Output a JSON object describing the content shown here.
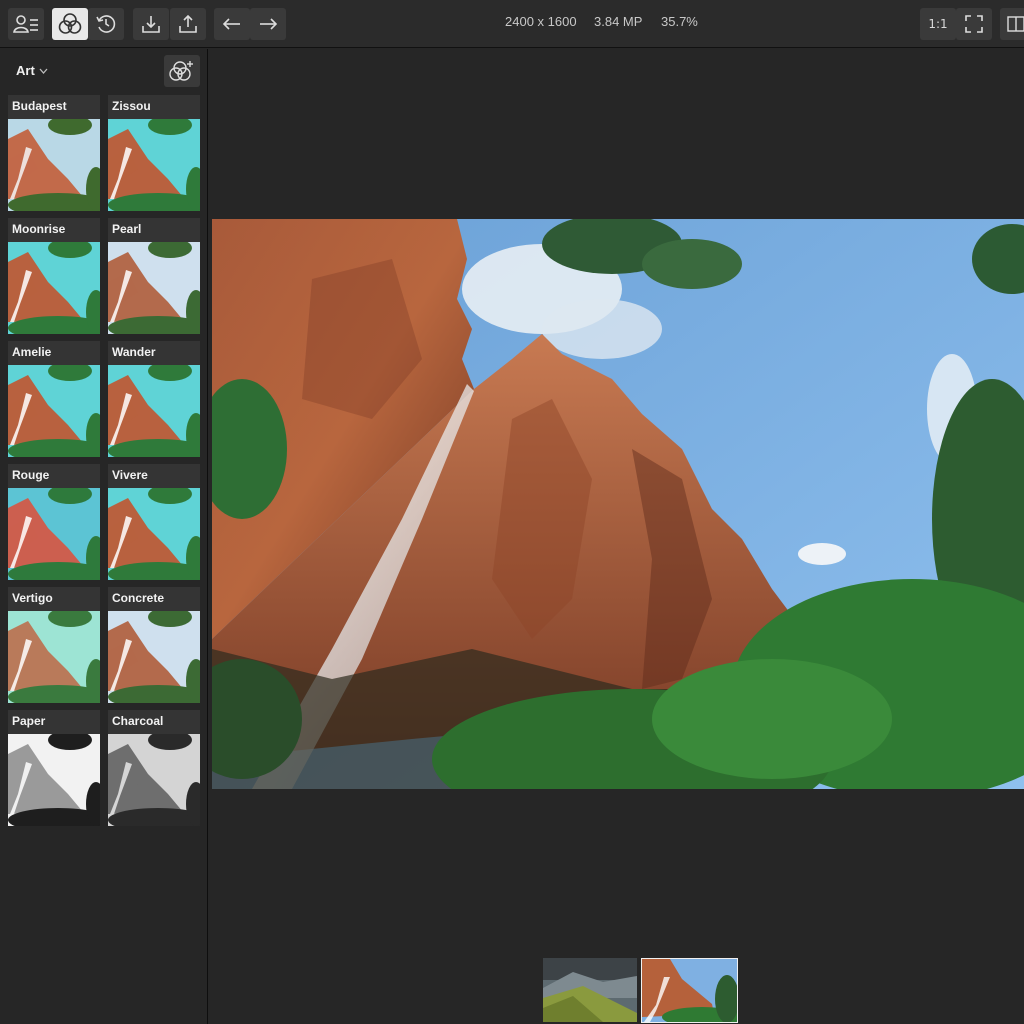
{
  "toolbar": {
    "image_size": "2400 x 1600",
    "megapixels": "3.84 MP",
    "zoom": "35.7%",
    "actual_size_label": "1:1",
    "compare_label": "B|A",
    "icons": [
      "user-menu-icon",
      "presets-icon",
      "history-icon",
      "download-icon",
      "share-icon",
      "undo-icon",
      "redo-icon",
      "fit-screen-icon"
    ]
  },
  "sidebar": {
    "category": "Art",
    "presets": [
      {
        "name": "Budapest",
        "tone": "warm"
      },
      {
        "name": "Zissou",
        "tone": "teal"
      },
      {
        "name": "Moonrise",
        "tone": "teal"
      },
      {
        "name": "Pearl",
        "tone": "neutral"
      },
      {
        "name": "Amelie",
        "tone": "teal"
      },
      {
        "name": "Wander",
        "tone": "teal"
      },
      {
        "name": "Rouge",
        "tone": "rose"
      },
      {
        "name": "Vivere",
        "tone": "teal"
      },
      {
        "name": "Vertigo",
        "tone": "mint"
      },
      {
        "name": "Concrete",
        "tone": "neutral"
      },
      {
        "name": "Paper",
        "tone": "bw-high"
      },
      {
        "name": "Charcoal",
        "tone": "bw-dark"
      }
    ]
  },
  "colors": {
    "panel": "#262626",
    "toolbar": "#2b2b2b",
    "button": "#3a3a3a",
    "active_button": "#e8e8e8"
  }
}
